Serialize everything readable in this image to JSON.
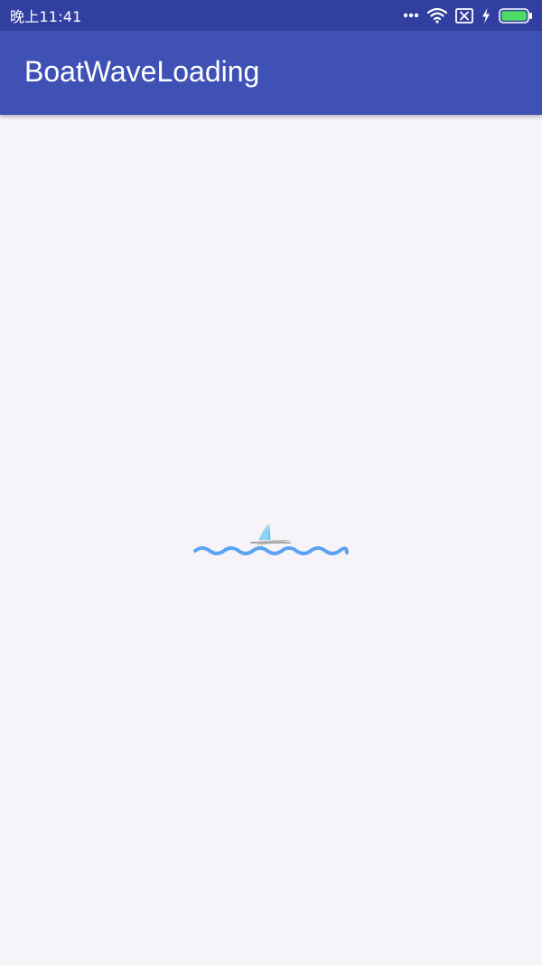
{
  "status_bar": {
    "time": "晚上11:41",
    "icons": [
      "more-dots-icon",
      "wifi-icon",
      "no-sim-icon",
      "charging-icon",
      "battery-icon"
    ],
    "battery_color": "#4cd964",
    "background_color": "#3140a0"
  },
  "app_bar": {
    "title": "BoatWaveLoading",
    "background_color": "#3f51b5"
  },
  "loader": {
    "icons": [
      "boat-icon",
      "wave-icon"
    ],
    "wave_color": "#5aa3f0",
    "sail_color": "#8fd3f4",
    "hull_color": "#b8b8b8"
  }
}
